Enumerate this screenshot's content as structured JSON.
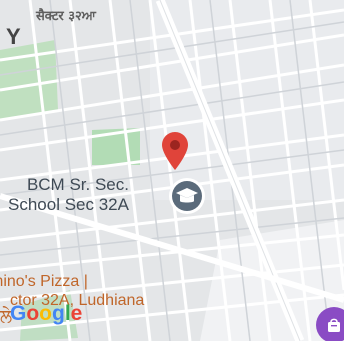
{
  "map": {
    "area_label": "सैक्टर ३२ਆ",
    "edge_letter": "Y",
    "poi_school": {
      "line1": "BCM Sr. Sec.",
      "line2": "School Sec 32A",
      "icon": "graduation-cap-icon"
    },
    "poi_pizza": {
      "line1": "mino's Pizza |",
      "line2": "ctor 32A, Ludhiana"
    },
    "attribution": {
      "letters": [
        "G",
        "o",
        "o",
        "g",
        "l",
        "e"
      ],
      "colors": [
        "#4285F4",
        "#EA4335",
        "#FBBC05",
        "#4285F4",
        "#34A853",
        "#EA4335"
      ]
    },
    "partial_text": "ਲੇ",
    "pin_icon": "location-pin-icon",
    "fab_icon": "shopping-bag-icon",
    "colors": {
      "pin": "#e0443a",
      "school_marker": "#5b6b7b",
      "park": "#a5d9a7",
      "fab": "#8a4cc4"
    }
  }
}
